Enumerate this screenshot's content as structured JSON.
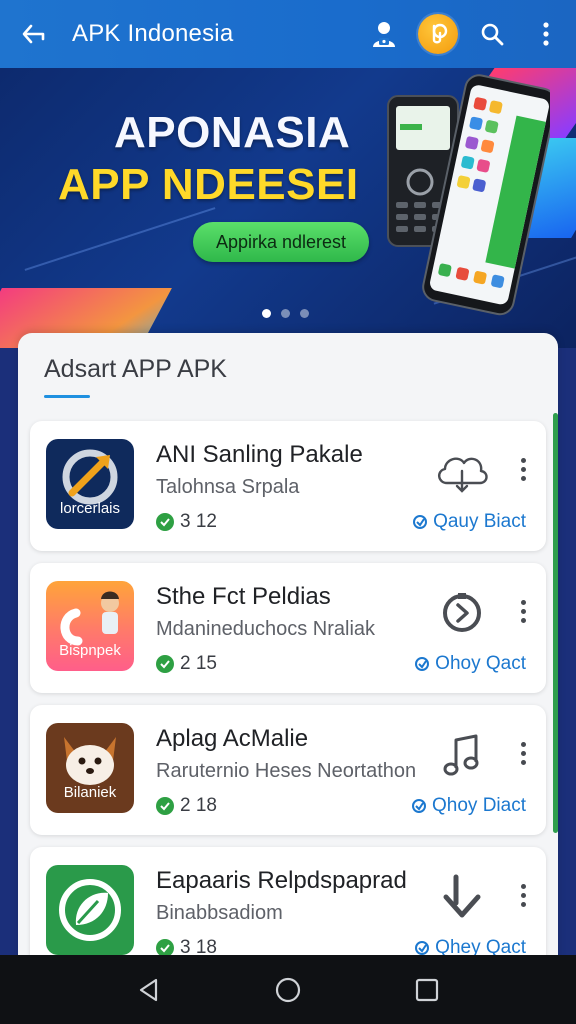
{
  "appbar": {
    "title": "APK Indonesia",
    "icons": [
      "back-arrow-icon",
      "user-lock-icon",
      "coin-icon",
      "search-icon",
      "more-vert-icon"
    ]
  },
  "banner": {
    "headline": "APONASIA",
    "subheadline": "APP NDEESEI",
    "cta_label": "Appirka ndlerest",
    "carousel": {
      "pages": 3,
      "active": 1
    }
  },
  "list": {
    "section_title": "Adsart APP APK",
    "items": [
      {
        "icon_label": "lorcerlais",
        "name": "ANI Sanling Pakale",
        "subtitle": "Talohnsa Srpala",
        "rating": "3 12",
        "status": "Qauy Biact",
        "action_icon": "cloud-download-icon",
        "accent": "#0f2a5c"
      },
      {
        "icon_label": "Bispnpek",
        "name": "Sthe Fct Peldias",
        "subtitle": "Mdanineduchocs Nraliak",
        "rating": "2 15",
        "status": "Ohoy Qact",
        "action_icon": "refresh-circle-icon",
        "accent": "#ff7a6a"
      },
      {
        "icon_label": "Bilaniek",
        "name": "Aplag AcMalie",
        "subtitle": "Raruternio Heses Neortathon",
        "rating": "2 18",
        "status": "Qhoy Diact",
        "action_icon": "music-note-icon",
        "accent": "#6b3a1e"
      },
      {
        "icon_label": "",
        "name": "Eapaaris Relpdspaprad",
        "subtitle": "Binabbsadiom",
        "rating": "3 18",
        "status": "Qhey Qact",
        "action_icon": "download-arrow-icon",
        "accent": "#2a9a4a"
      }
    ]
  },
  "navbar": {
    "icons": [
      "back-triangle-icon",
      "home-circle-icon",
      "recents-square-icon"
    ]
  }
}
